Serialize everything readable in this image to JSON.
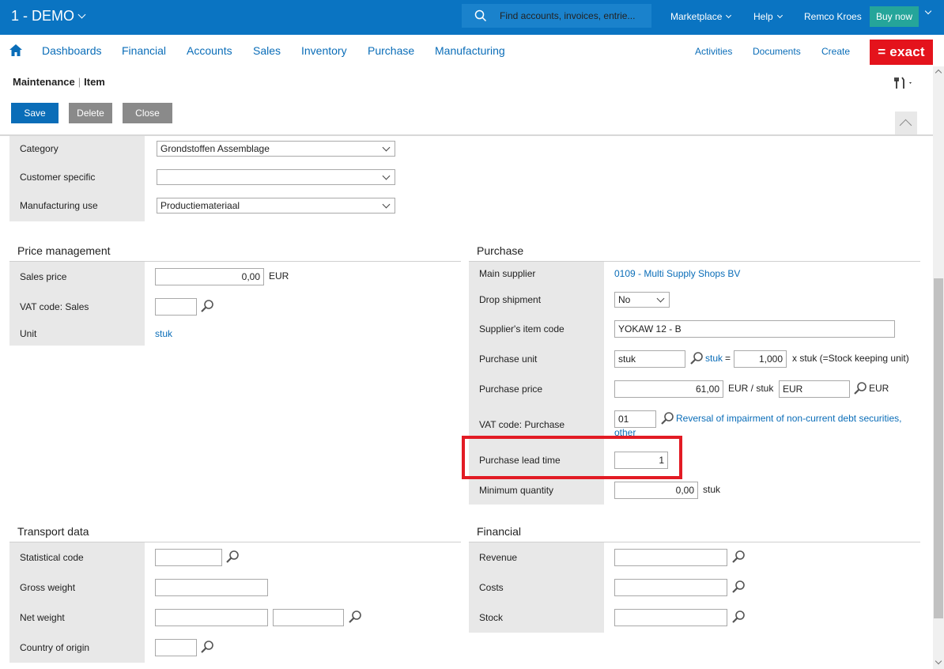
{
  "topbar": {
    "company": "1 - DEMO",
    "search_placeholder": "Find accounts, invoices, entrie...",
    "marketplace": "Marketplace",
    "help": "Help",
    "user": "Remco Kroes",
    "buy_now": "Buy now",
    "colors": {
      "bar": "#0a74c2",
      "buy_now": "#25a59a"
    }
  },
  "nav": {
    "items": [
      "Dashboards",
      "Financial",
      "Accounts",
      "Sales",
      "Inventory",
      "Purchase",
      "Manufacturing"
    ],
    "right_items": [
      "Activities",
      "Documents",
      "Create"
    ],
    "logo": "= exact",
    "logo_color": "#e4131c"
  },
  "page": {
    "title_part1": "Maintenance",
    "title_part2": "Item",
    "buttons": {
      "save": "Save",
      "delete": "Delete",
      "close": "Close"
    }
  },
  "general": {
    "category_label": "Category",
    "category_value": "Grondstoffen Assemblage",
    "customer_specific_label": "Customer specific",
    "customer_specific_value": "",
    "manufacturing_use_label": "Manufacturing use",
    "manufacturing_use_value": "Productiemateriaal"
  },
  "price_management": {
    "title": "Price management",
    "sales_price_label": "Sales price",
    "sales_price_value": "0,00",
    "sales_price_currency": "EUR",
    "vat_code_label": "VAT code: Sales",
    "vat_code_value": "",
    "unit_label": "Unit",
    "unit_value": "stuk"
  },
  "purchase": {
    "title": "Purchase",
    "main_supplier_label": "Main supplier",
    "main_supplier_value": "0109 - Multi Supply Shops BV",
    "drop_shipment_label": "Drop shipment",
    "drop_shipment_value": "No",
    "supplier_item_code_label": "Supplier's item code",
    "supplier_item_code_value": "YOKAW 12 - B",
    "purchase_unit_label": "Purchase unit",
    "purchase_unit_value": "stuk",
    "purchase_unit_link": "stuk",
    "purchase_unit_equals": "=",
    "purchase_unit_factor": "1,000",
    "purchase_unit_suffix": "x stuk (=Stock keeping unit)",
    "purchase_price_label": "Purchase price",
    "purchase_price_value": "61,00",
    "purchase_price_per": "EUR / stuk",
    "purchase_currency_value": "EUR",
    "purchase_currency_suffix": "EUR",
    "vat_code_label": "VAT code: Purchase",
    "vat_code_value": "01",
    "vat_code_desc_line1": "Reversal of impairment of non-current debt securities,",
    "vat_code_desc_line2": "other",
    "lead_time_label": "Purchase lead time",
    "lead_time_value": "1",
    "min_qty_label": "Minimum quantity",
    "min_qty_value": "0,00",
    "min_qty_unit": "stuk"
  },
  "transport": {
    "title": "Transport data",
    "statistical_code_label": "Statistical code",
    "statistical_code_value": "",
    "gross_weight_label": "Gross weight",
    "gross_weight_value": "",
    "net_weight_label": "Net weight",
    "net_weight_value": "",
    "net_weight_unit_value": "",
    "country_label": "Country of origin",
    "country_value": ""
  },
  "financial": {
    "title": "Financial",
    "revenue_label": "Revenue",
    "revenue_value": "",
    "costs_label": "Costs",
    "costs_value": "",
    "stock_label": "Stock",
    "stock_value": ""
  },
  "annotation": {
    "highlight_color": "#e21b24"
  }
}
